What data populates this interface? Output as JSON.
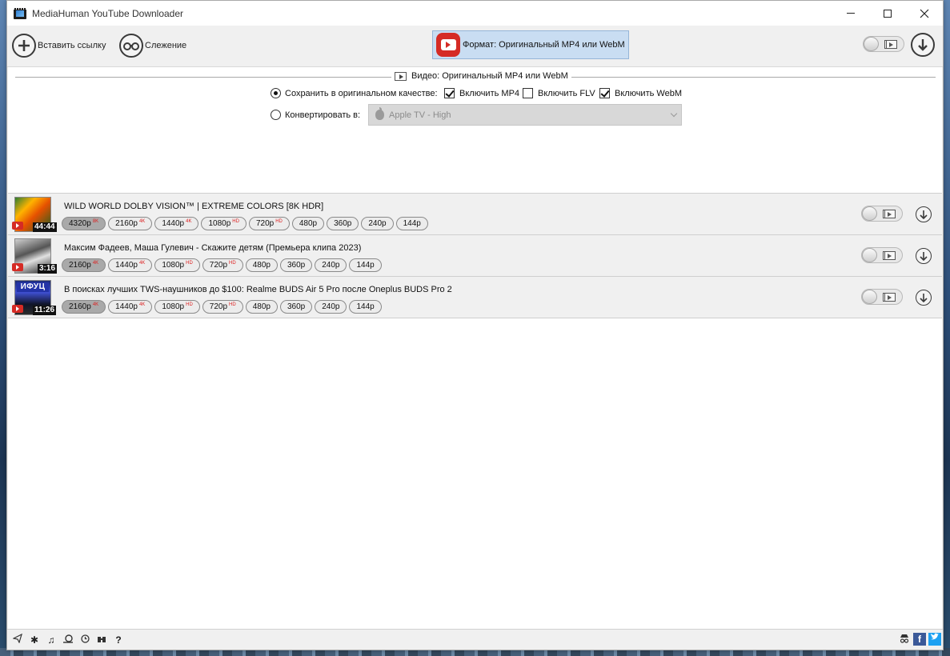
{
  "window": {
    "title": "MediaHuman YouTube Downloader"
  },
  "toolbar": {
    "paste_label": "Вставить ссылку",
    "tracking_label": "Слежение",
    "format_label": "Формат: Оригинальный MP4 или WebM"
  },
  "settings": {
    "panel_title": "Видео: Оригинальный MP4 или WebM",
    "keep_original_label": "Сохранить в оригинальном качестве:",
    "keep_original_selected": true,
    "include_mp4_label": "Включить MP4",
    "include_mp4_checked": true,
    "include_flv_label": "Включить FLV",
    "include_flv_checked": false,
    "include_webm_label": "Включить WebM",
    "include_webm_checked": true,
    "convert_label": "Конвертировать в:",
    "convert_selected": false,
    "convert_target": "Apple TV - High"
  },
  "videos": [
    {
      "title": "WILD WORLD DOLBY VISION™ | EXTREME COLORS [8K HDR]",
      "duration": "44:44",
      "qualities": [
        {
          "label": "4320p",
          "badge": "8K",
          "selected": true
        },
        {
          "label": "2160p",
          "badge": "4K"
        },
        {
          "label": "1440p",
          "badge": "4K"
        },
        {
          "label": "1080p",
          "badge": "HD"
        },
        {
          "label": "720p",
          "badge": "HD"
        },
        {
          "label": "480p",
          "badge": ""
        },
        {
          "label": "360p",
          "badge": ""
        },
        {
          "label": "240p",
          "badge": ""
        },
        {
          "label": "144p",
          "badge": ""
        }
      ]
    },
    {
      "title": "Максим Фадеев, Маша Гулевич - Скажите детям (Премьера клипа 2023)",
      "duration": "3:16",
      "qualities": [
        {
          "label": "2160p",
          "badge": "4K",
          "selected": true
        },
        {
          "label": "1440p",
          "badge": "4K"
        },
        {
          "label": "1080p",
          "badge": "HD"
        },
        {
          "label": "720p",
          "badge": "HD"
        },
        {
          "label": "480p",
          "badge": ""
        },
        {
          "label": "360p",
          "badge": ""
        },
        {
          "label": "240p",
          "badge": ""
        },
        {
          "label": "144p",
          "badge": ""
        }
      ]
    },
    {
      "title": "В поисках лучших TWS-наушников до $100: Realme BUDS Air 5 Pro после Oneplus BUDS Pro 2",
      "duration": "11:26",
      "thumb_text": "ИФУЦ",
      "qualities": [
        {
          "label": "2160p",
          "badge": "4K",
          "selected": true
        },
        {
          "label": "1440p",
          "badge": "4K"
        },
        {
          "label": "1080p",
          "badge": "HD"
        },
        {
          "label": "720p",
          "badge": "HD"
        },
        {
          "label": "480p",
          "badge": ""
        },
        {
          "label": "360p",
          "badge": ""
        },
        {
          "label": "240p",
          "badge": ""
        },
        {
          "label": "144p",
          "badge": ""
        }
      ]
    }
  ],
  "statusbar": {
    "left_icons": [
      "send-icon",
      "gear-icon",
      "music-note-icon",
      "snail-icon",
      "clock-icon",
      "binoculars-icon",
      "help-icon"
    ],
    "help_label": "?",
    "fb_label": "f"
  },
  "colors": {
    "format_button_bg": "#c9ddf2",
    "youtube_red": "#d52b25",
    "hd_badge": "#dd2222"
  }
}
